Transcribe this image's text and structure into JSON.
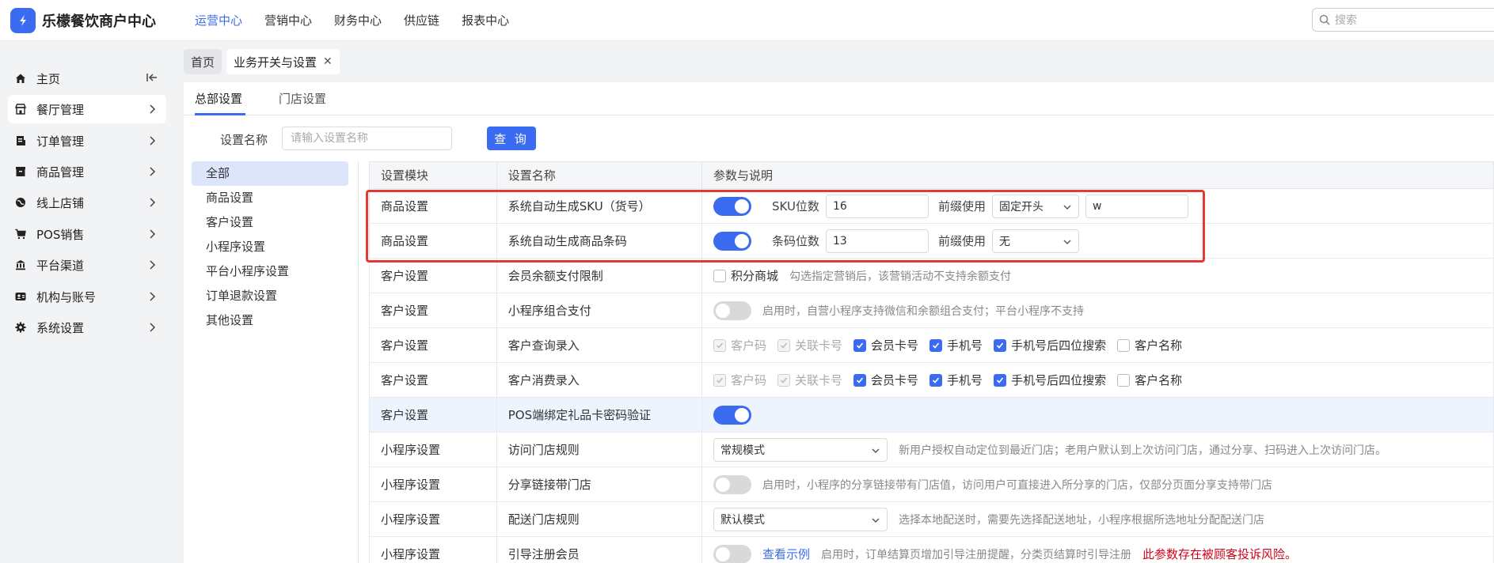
{
  "app": {
    "title": "乐檬餐饮商户中心",
    "logo_glyph": "✓"
  },
  "topnav": [
    "运营中心",
    "营销中心",
    "财务中心",
    "供应链",
    "报表中心"
  ],
  "search": {
    "placeholder": "搜索"
  },
  "sidebar": {
    "items": [
      {
        "label": "主页",
        "icon": "home-icon"
      },
      {
        "label": "餐厅管理",
        "icon": "store-icon"
      },
      {
        "label": "订单管理",
        "icon": "receipt-icon"
      },
      {
        "label": "商品管理",
        "icon": "box-icon"
      },
      {
        "label": "线上店铺",
        "icon": "globe-icon"
      },
      {
        "label": "POS销售",
        "icon": "cart-icon"
      },
      {
        "label": "平台渠道",
        "icon": "bank-icon"
      },
      {
        "label": "机构与账号",
        "icon": "people-icon"
      },
      {
        "label": "系统设置",
        "icon": "gear-icon"
      }
    ]
  },
  "tabs": {
    "home": "首页",
    "current": "业务开关与设置"
  },
  "subtabs": [
    "总部设置",
    "门店设置"
  ],
  "filter": {
    "label": "设置名称",
    "placeholder": "请输入设置名称",
    "button": "查 询"
  },
  "categories": [
    "全部",
    "商品设置",
    "客户设置",
    "小程序设置",
    "平台小程序设置",
    "订单退款设置",
    "其他设置"
  ],
  "table": {
    "headers": [
      "设置模块",
      "设置名称",
      "参数与说明"
    ],
    "rows": [
      {
        "module": "商品设置",
        "name": "系统自动生成SKU（货号）",
        "lbl1": "SKU位数",
        "val1": "16",
        "lbl2": "前缀使用",
        "sel": "固定开头",
        "val2": "w"
      },
      {
        "module": "商品设置",
        "name": "系统自动生成商品条码",
        "lbl1": "条码位数",
        "val1": "13",
        "lbl2": "前缀使用",
        "sel": "无"
      },
      {
        "module": "客户设置",
        "name": "会员余额支付限制",
        "cb": "积分商城",
        "desc": "勾选指定营销后，该营销活动不支持余额支付"
      },
      {
        "module": "客户设置",
        "name": "小程序组合支付",
        "desc": "启用时，自营小程序支持微信和余额组合支付；平台小程序不支持"
      },
      {
        "module": "客户设置",
        "name": "客户查询录入",
        "opts": [
          "客户码",
          "关联卡号",
          "会员卡号",
          "手机号",
          "手机号后四位搜索",
          "客户名称"
        ]
      },
      {
        "module": "客户设置",
        "name": "客户消费录入",
        "opts": [
          "客户码",
          "关联卡号",
          "会员卡号",
          "手机号",
          "手机号后四位搜索",
          "客户名称"
        ]
      },
      {
        "module": "客户设置",
        "name": "POS端绑定礼品卡密码验证"
      },
      {
        "module": "小程序设置",
        "name": "访问门店规则",
        "sel": "常规模式",
        "desc": "新用户授权自动定位到最近门店；老用户默认到上次访问门店，通过分享、扫码进入上次访问门店。"
      },
      {
        "module": "小程序设置",
        "name": "分享链接带门店",
        "desc": "启用时，小程序的分享链接带有门店值，访问用户可直接进入所分享的门店，仅部分页面分享支持带门店"
      },
      {
        "module": "小程序设置",
        "name": "配送门店规则",
        "sel": "默认模式",
        "desc": "选择本地配送时，需要先选择配送地址，小程序根据所选地址分配配送门店"
      },
      {
        "module": "小程序设置",
        "name": "引导注册会员",
        "link": "查看示例",
        "desc": "启用时，订单结算页增加引导注册提醒，分类页结算时引导注册",
        "warn": "此参数存在被顾客投诉风险。"
      }
    ]
  },
  "colors": {
    "accent": "#3b6bf0",
    "highlight_border": "#e53935"
  }
}
